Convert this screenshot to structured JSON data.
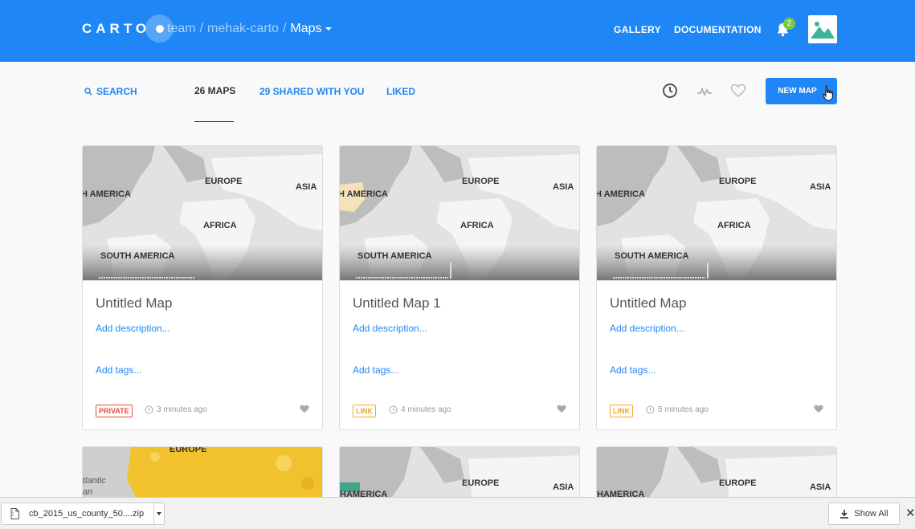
{
  "header": {
    "logo": "CARTO",
    "breadcrumb": {
      "org": "team",
      "sep1": "/",
      "user": "mehak-carto",
      "sep2": "/",
      "current": "Maps"
    },
    "links": {
      "gallery": "GALLERY",
      "documentation": "DOCUMENTATION"
    },
    "notifications_count": "2",
    "colors": {
      "brand": "#1f87f5",
      "badge": "#7ac943"
    }
  },
  "filters": {
    "search_label": "SEARCH",
    "tabs": [
      {
        "label": "26 MAPS",
        "active": true
      },
      {
        "label": "29 SHARED WITH YOU",
        "active": false
      },
      {
        "label": "LIKED",
        "active": false
      }
    ],
    "view_icons": [
      "clock-icon",
      "activity-icon",
      "heart-icon"
    ],
    "new_map_label": "NEW MAP"
  },
  "cards": [
    {
      "title": "Untitled Map",
      "description": "Add description...",
      "tags": "Add tags...",
      "privacy": "PRIVATE",
      "time": "3 minutes ago",
      "map_labels": {
        "europe": "EUROPE",
        "asia": "ASIA",
        "america": "H AMERICA",
        "africa": "AFRICA",
        "south_america": "SOUTH AMERICA"
      }
    },
    {
      "title": "Untitled Map 1",
      "description": "Add description...",
      "tags": "Add tags...",
      "privacy": "LINK",
      "time": "4 minutes ago",
      "map_labels": {
        "europe": "EUROPE",
        "asia": "ASIA",
        "america": "H AMERICA",
        "africa": "AFRICA",
        "south_america": "SOUTH AMERICA"
      }
    },
    {
      "title": "Untitled Map",
      "description": "Add description...",
      "tags": "Add tags...",
      "privacy": "LINK",
      "time": "5 minutes ago",
      "map_labels": {
        "europe": "EUROPE",
        "asia": "ASIA",
        "america": "H AMERICA",
        "africa": "AFRICA",
        "south_america": "SOUTH AMERICA"
      }
    }
  ],
  "second_row": [
    {
      "labels": {
        "europe": "EUROPE",
        "atlantic": "tlantic",
        "atlantic2": "an"
      }
    },
    {
      "labels": {
        "europe": "EUROPE",
        "asia": "ASIA",
        "america": "HAMERICA"
      }
    },
    {
      "labels": {
        "europe": "EUROPE",
        "asia": "ASIA",
        "america": "HAMERICA"
      }
    }
  ],
  "download_bar": {
    "file_name": "cb_2015_us_county_50....zip",
    "show_all": "Show All",
    "close": "✕"
  }
}
